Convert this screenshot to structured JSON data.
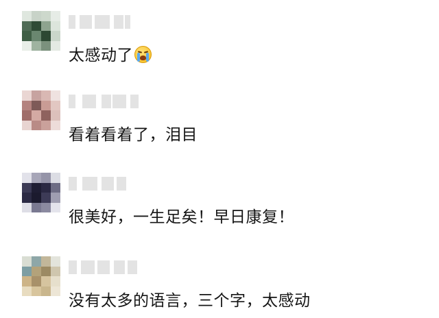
{
  "comments": [
    {
      "text": "太感动了",
      "emoji": "crying-face-icon",
      "avatar_colors": [
        "#dfe7df",
        "#c8d3c8",
        "#cdd8cc",
        "#e6ece6",
        "#4f6b55",
        "#2f4b36",
        "#8ea48f",
        "#dce5dc",
        "#3f5e45",
        "#6a8770",
        "#2d4833",
        "#cad6ca",
        "#e9eee8",
        "#9fb3a0",
        "#7b917d",
        "#e4eae3"
      ]
    },
    {
      "text": "看着看着了，泪目",
      "emoji": "",
      "avatar_colors": [
        "#ead6d3",
        "#c7a3a0",
        "#d9b8b3",
        "#efe2e0",
        "#b4837f",
        "#7e5a58",
        "#c99c95",
        "#e2c7c2",
        "#a06e6a",
        "#d4aaa3",
        "#8f625e",
        "#dcc0bb",
        "#e8d4d1",
        "#b98b86",
        "#caa19b",
        "#eddcd9"
      ]
    },
    {
      "text": "很美好，一生足矣！早日康复！",
      "emoji": "",
      "avatar_colors": [
        "#e2e2ea",
        "#a7a6b8",
        "#9594a8",
        "#dcdde4",
        "#3b3a55",
        "#1e1d33",
        "#2a2842",
        "#6d6c84",
        "#2b2a44",
        "#1b1a2e",
        "#3d3b57",
        "#9f9eb1",
        "#dedee6",
        "#7a7991",
        "#8b8aa0",
        "#e4e4ec"
      ]
    },
    {
      "text": "没有太多的语言，三个字，太感动",
      "emoji": "",
      "avatar_colors": [
        "#d9ddd3",
        "#8ea7a8",
        "#c2b79a",
        "#e3e4dc",
        "#7d9ea3",
        "#b3a27a",
        "#9c8a63",
        "#cfc6ae",
        "#cdb487",
        "#a8916a",
        "#d6c49f",
        "#e6dfcc",
        "#e8dcc0",
        "#d8c59d",
        "#c9b68d",
        "#ede6d6"
      ]
    }
  ]
}
